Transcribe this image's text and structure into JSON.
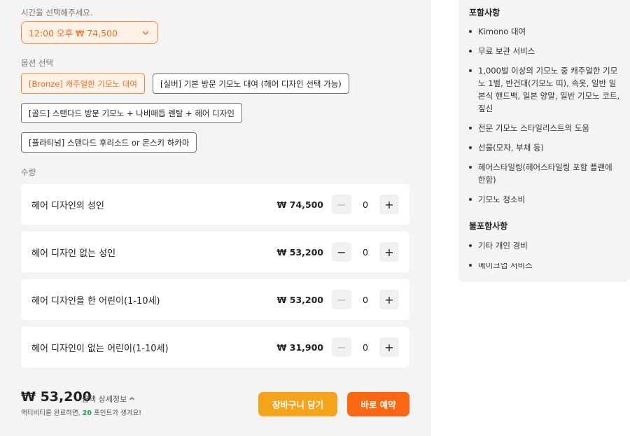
{
  "time_section": {
    "label": "시간을 선택해주세요.",
    "selected": "12:00 오후 ₩ 74,500"
  },
  "options_section": {
    "label": "옵션 선택",
    "options": [
      {
        "label": "[Bronze] 캐주얼한 기모노 대여",
        "selected": true
      },
      {
        "label": "[실버] 기본 방문 기모노 대여 (헤어 디자인 선택 가능)",
        "selected": false
      },
      {
        "label": "[골드] 스탠다드 방문 기모노 + 나비매듭 렌탈 + 헤어 디자인",
        "selected": false
      },
      {
        "label": "[플라티넘] 스탠다드 후리소드 or 몬스키 하카마",
        "selected": false
      }
    ]
  },
  "quantity_section": {
    "label": "수량",
    "rows": [
      {
        "name": "헤어 디자인의 성인",
        "price": "₩ 74,500",
        "qty": "0",
        "minus_disabled": true
      },
      {
        "name": "헤어 디자인 없는 성인",
        "price": "₩ 53,200",
        "qty": "0",
        "minus_disabled": false
      },
      {
        "name": "헤어 디자인을 한 어린이(1-10세)",
        "price": "₩ 53,200",
        "qty": "0",
        "minus_disabled": true
      },
      {
        "name": "헤어 디자인이 없는 어린이(1-10세)",
        "price": "₩ 31,900",
        "qty": "0",
        "minus_disabled": true
      }
    ]
  },
  "footer": {
    "total": "₩ 53,200",
    "detail_link": "금액 상세정보",
    "points_prefix": "액티비티를 완료하면,",
    "points_value": "20",
    "points_suffix": "포인트가 생겨요!",
    "cart_button": "장바구니 담기",
    "book_button": "바로 예약"
  },
  "info_card": {
    "included_heading": "포함사항",
    "included_items": [
      "Kimono 대여",
      "무료 보관 서비스",
      "1,000벌 이상의 기모노 중 캐주얼한 기모노 1벌, 반건대(기모노 띠), 속옷, 일반 일본식 핸드백, 일본 양말, 일반 기모노 코트, 짚신",
      "전문 기모노 스타일리스트의 도움",
      "선물(모자, 부채 등)",
      "헤어스타일링(헤어스타일링 포함 플랜에 한함)",
      "기모노 청소비"
    ],
    "excluded_heading": "불포함사항",
    "excluded_items": [
      "기타 개인 경비",
      "메이크업 서비스"
    ]
  },
  "colors": {
    "accent_orange": "#fb6611",
    "accent_yellow": "#f5a31a",
    "points_green": "#21a04b",
    "panel_bg": "#f4f4f5"
  }
}
